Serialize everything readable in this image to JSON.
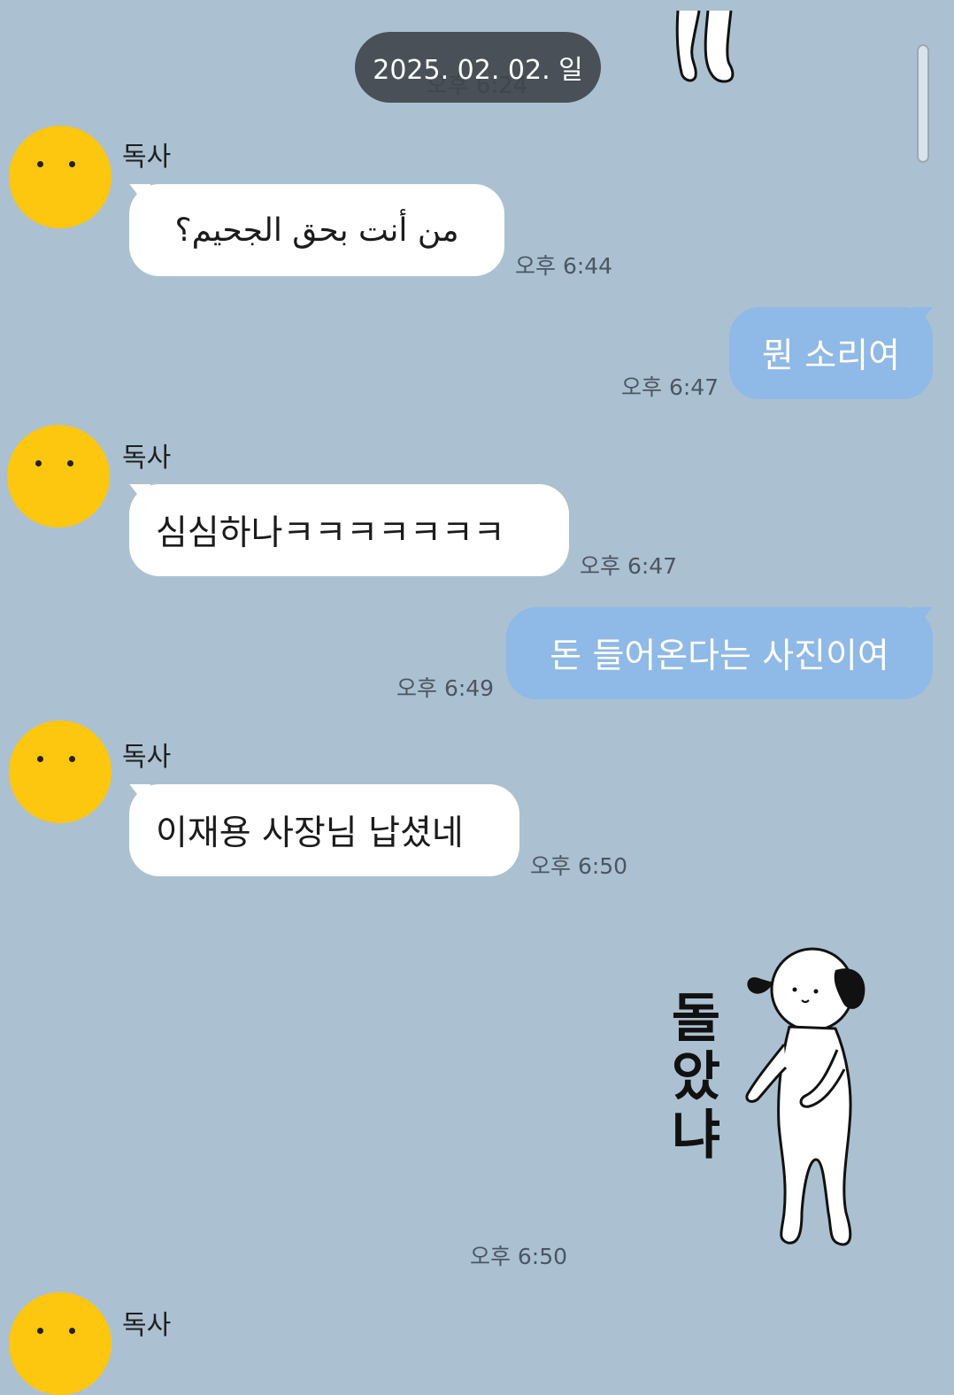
{
  "header": {
    "date": "2025. 02. 02. 일",
    "time": "오후 6:24"
  },
  "messages": [
    {
      "sender": "독사",
      "text": "من أنت بحق الجحيم؟",
      "time": "오후 6:44"
    },
    {
      "text": "뭔 소리여",
      "time": "오후 6:47"
    },
    {
      "sender": "독사",
      "text": "심심하나ㅋㅋㅋㅋㅋㅋㅋ",
      "time": "오후 6:47"
    },
    {
      "text": "돈 들어온다는 사진이여",
      "time": "오후 6:49"
    },
    {
      "sender": "독사",
      "text": "이재용 사장님 납셨네",
      "time": "오후 6:50"
    },
    {
      "sticker_text": "돌았냐",
      "time": "오후 6:50"
    },
    {
      "sender": "독사"
    }
  ],
  "colors": {
    "background": "#abc1d1",
    "my_bubble": "#8fb9e6",
    "their_bubble": "#ffffff",
    "avatar": "#fdc60f"
  }
}
